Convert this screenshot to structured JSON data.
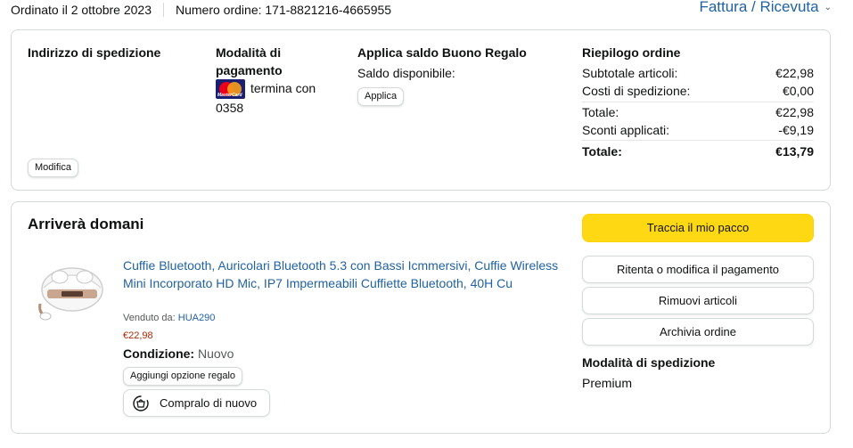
{
  "header": {
    "order_date": "Ordinato il 2 ottobre 2023",
    "order_number": "Numero ordine: 171-8821216-4665955",
    "invoice_link": "Fattura / Ricevuta"
  },
  "summary": {
    "shipping_address_heading": "Indirizzo di spedizione",
    "modify_button": "Modifica",
    "payment_heading": "Modalità di pagamento",
    "card_logo_text": "MasterCard",
    "card_suffix": "termina con 0358",
    "gift_heading": "Applica saldo Buono Regalo",
    "gift_balance_label": "Saldo disponibile:",
    "apply_button": "Applica",
    "order_summary_heading": "Riepilogo ordine",
    "rows": [
      {
        "label": "Subtotale articoli:",
        "value": "€22,98"
      },
      {
        "label": "Costi di spedizione:",
        "value": "€0,00"
      },
      {
        "label": "Totale:",
        "value": "€22,98"
      },
      {
        "label": "Sconti applicati:",
        "value": "-€9,19"
      },
      {
        "label": "Totale:",
        "value": "€13,79"
      }
    ]
  },
  "shipment": {
    "status": "Arriverà domani",
    "product_title": "Cuffie Bluetooth, Auricolari Bluetooth 5.3 con Bassi Icmmersivi, Cuffie Wireless Mini Incorporato HD Mic, IP7 Impermeabili Cuffiette Bluetooth, 40H Cu",
    "sold_by_label": "Venduto da:",
    "seller": "HUA290",
    "price": "€22,98",
    "condition_label": "Condizione:",
    "condition_value": "Nuovo",
    "gift_option_button": "Aggiungi opzione regalo",
    "buy_again_button": "Compralo di nuovo",
    "actions": {
      "track": "Traccia il mio pacco",
      "retry_payment": "Ritenta o modifica il pagamento",
      "remove_items": "Rimuovi articoli",
      "archive": "Archivia ordine"
    },
    "shipping_method_heading": "Modalità di spedizione",
    "shipping_method_value": "Premium"
  },
  "colors": {
    "link": "#2162a1",
    "price": "#b12704",
    "primary_button": "#ffd814",
    "border": "#d5d9d9"
  }
}
